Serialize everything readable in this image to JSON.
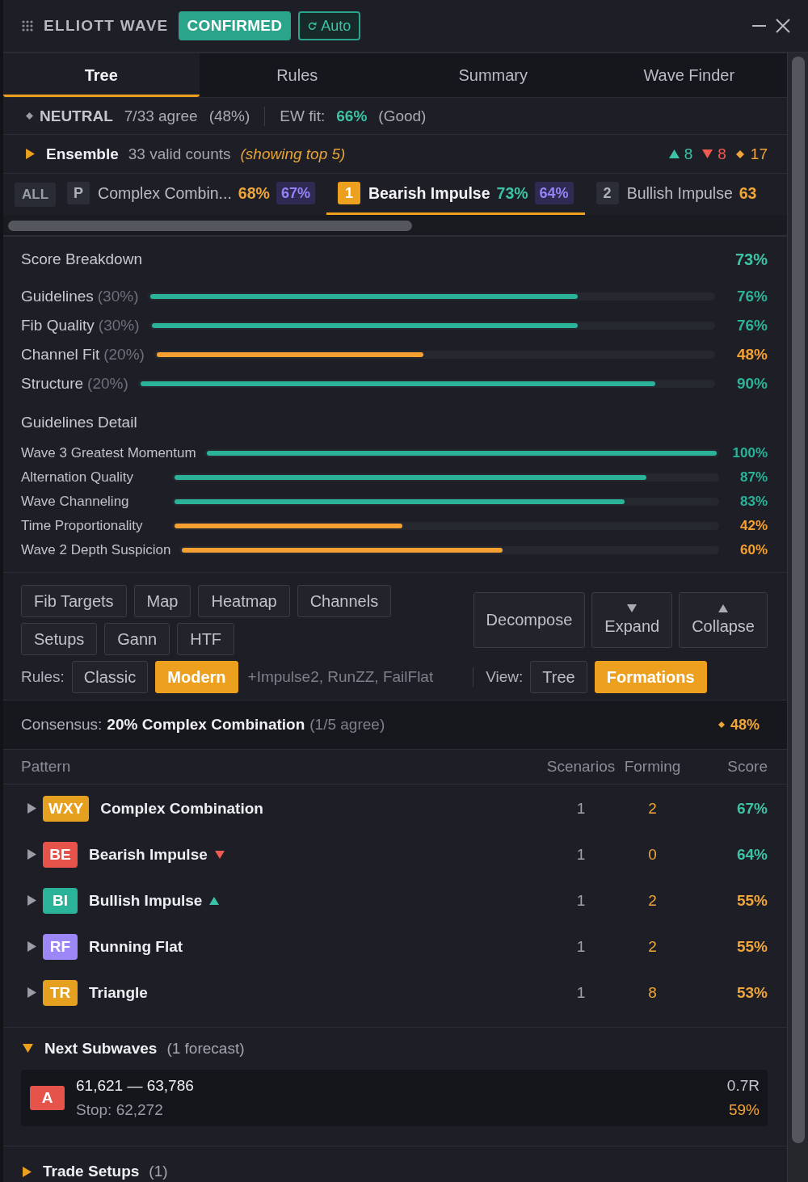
{
  "header": {
    "title": "ELLIOTT WAVE",
    "status": "CONFIRMED",
    "mode": "Auto"
  },
  "tabs": [
    {
      "label": "Tree",
      "selected": true
    },
    {
      "label": "Rules",
      "selected": false
    },
    {
      "label": "Summary",
      "selected": false
    },
    {
      "label": "Wave Finder",
      "selected": false
    }
  ],
  "bias": {
    "label": "NEUTRAL",
    "agree": "7/33 agree",
    "share": "(48%)",
    "fit_label": "EW fit:",
    "fit": "66%",
    "fit_note": "(Good)"
  },
  "ensemble": {
    "title": "Ensemble",
    "expanded": false,
    "count": "33 valid counts",
    "note": "(showing top 5)",
    "tallies": [
      {
        "kind": "up",
        "value": "8"
      },
      {
        "kind": "down",
        "value": "8"
      },
      {
        "kind": "neutral",
        "value": "17"
      }
    ]
  },
  "scenarios": [
    {
      "kind": "all",
      "label": "ALL",
      "selected": false
    },
    {
      "kind": "scenario",
      "rank": "P",
      "name": "Complex Combin...",
      "score": {
        "value": "68%",
        "color": "#f0a53a"
      },
      "fit": "67%",
      "selected": false
    },
    {
      "kind": "scenario",
      "rank": "1",
      "name": "Bearish Impulse",
      "score": {
        "value": "73%",
        "color": "#3cc3a5"
      },
      "fit": "64%",
      "selected": true
    },
    {
      "kind": "scenario",
      "rank": "2",
      "name": "Bullish Impulse",
      "score": {
        "value": "63",
        "color": "#f0a53a"
      },
      "selected": false
    }
  ],
  "score_breakdown": {
    "title": "Score Breakdown",
    "total": "73%",
    "rows": [
      {
        "label": "Guidelines",
        "weight": "(30%)",
        "level": 0.76,
        "value": "76%",
        "color": "#2bb39a"
      },
      {
        "label": "Fib Quality",
        "weight": "(30%)",
        "level": 0.76,
        "value": "76%",
        "color": "#2bb39a"
      },
      {
        "label": "Channel Fit",
        "weight": "(20%)",
        "level": 0.48,
        "value": "48%",
        "color": "#f5a030"
      },
      {
        "label": "Structure",
        "weight": "(20%)",
        "level": 0.9,
        "value": "90%",
        "color": "#2bb39a"
      }
    ]
  },
  "guidelines_detail": {
    "title": "Guidelines Detail",
    "rows": [
      {
        "label": "Wave 3 Greatest Momentum",
        "level": 1,
        "value": "100%",
        "color": "#2bb39a"
      },
      {
        "label": "Alternation Quality",
        "level": 0.87,
        "value": "87%",
        "color": "#2bb39a"
      },
      {
        "label": "Wave Channeling",
        "level": 0.83,
        "value": "83%",
        "color": "#2bb39a"
      },
      {
        "label": "Time Proportionality",
        "level": 0.42,
        "value": "42%",
        "color": "#f5a030"
      },
      {
        "label": "Wave 2 Depth Suspicion",
        "level": 0.6,
        "value": "60%",
        "color": "#f5a030"
      }
    ]
  },
  "tools": [
    [
      "Fib Targets",
      "Map",
      "Heatmap",
      "Channels"
    ],
    [
      "Setups",
      "Gann",
      "HTF"
    ]
  ],
  "actions": [
    {
      "kind": "plain",
      "label": "Decompose"
    },
    {
      "kind": "expand",
      "label": "Expand"
    },
    {
      "kind": "collapse",
      "label": "Collapse"
    }
  ],
  "rules": {
    "label": "Rules:",
    "options": [
      {
        "label": "Classic",
        "selected": false
      },
      {
        "label": "Modern",
        "selected": true
      }
    ],
    "note": "+Impulse2, RunZZ, FailFlat"
  },
  "view": {
    "label": "View:",
    "options": [
      {
        "label": "Tree",
        "selected": false
      },
      {
        "label": "Formations",
        "selected": true
      }
    ]
  },
  "consensus": {
    "label": "Consensus:",
    "value": "20% Complex Combination",
    "note": "(1/5 agree)",
    "score": "48%"
  },
  "patterns": {
    "columns": [
      "Pattern",
      "Scenarios",
      "Forming",
      "Score"
    ],
    "rows": [
      {
        "kind": "plain",
        "badge": "WXY",
        "color": "#e6a020",
        "name": "Complex Combination",
        "expanded": false,
        "scenarios": "1",
        "forming": "2",
        "score": {
          "value": "67%",
          "color": "#3cc3a5"
        }
      },
      {
        "kind": "bearish",
        "badge": "BE",
        "color": "#e5534b",
        "name": "Bearish Impulse",
        "expanded": false,
        "scenarios": "1",
        "forming": "0",
        "score": {
          "value": "64%",
          "color": "#3cc3a5"
        }
      },
      {
        "kind": "bullish",
        "badge": "BI",
        "color": "#2bb39a",
        "name": "Bullish Impulse",
        "expanded": false,
        "scenarios": "1",
        "forming": "2",
        "score": {
          "value": "55%",
          "color": "#f0a53a"
        }
      },
      {
        "kind": "plain",
        "badge": "RF",
        "color": "#9d86f5",
        "name": "Running Flat",
        "expanded": false,
        "scenarios": "1",
        "forming": "2",
        "score": {
          "value": "55%",
          "color": "#f0a53a"
        }
      },
      {
        "kind": "plain",
        "badge": "TR",
        "color": "#e6a020",
        "name": "Triangle",
        "expanded": false,
        "scenarios": "1",
        "forming": "8",
        "score": {
          "value": "53%",
          "color": "#f0a53a"
        }
      }
    ]
  },
  "next_subwaves": {
    "title": "Next Subwaves",
    "note": "(1 forecast)",
    "expanded": true,
    "forecasts": [
      {
        "label": "A",
        "color": "#e5534b",
        "range": "61,621 — 63,786",
        "stop": "Stop: 62,272",
        "ratio": "0.7R",
        "probability": "59%"
      }
    ]
  },
  "trade_setups": {
    "title": "Trade Setups",
    "note": "(1)",
    "expanded": false
  }
}
